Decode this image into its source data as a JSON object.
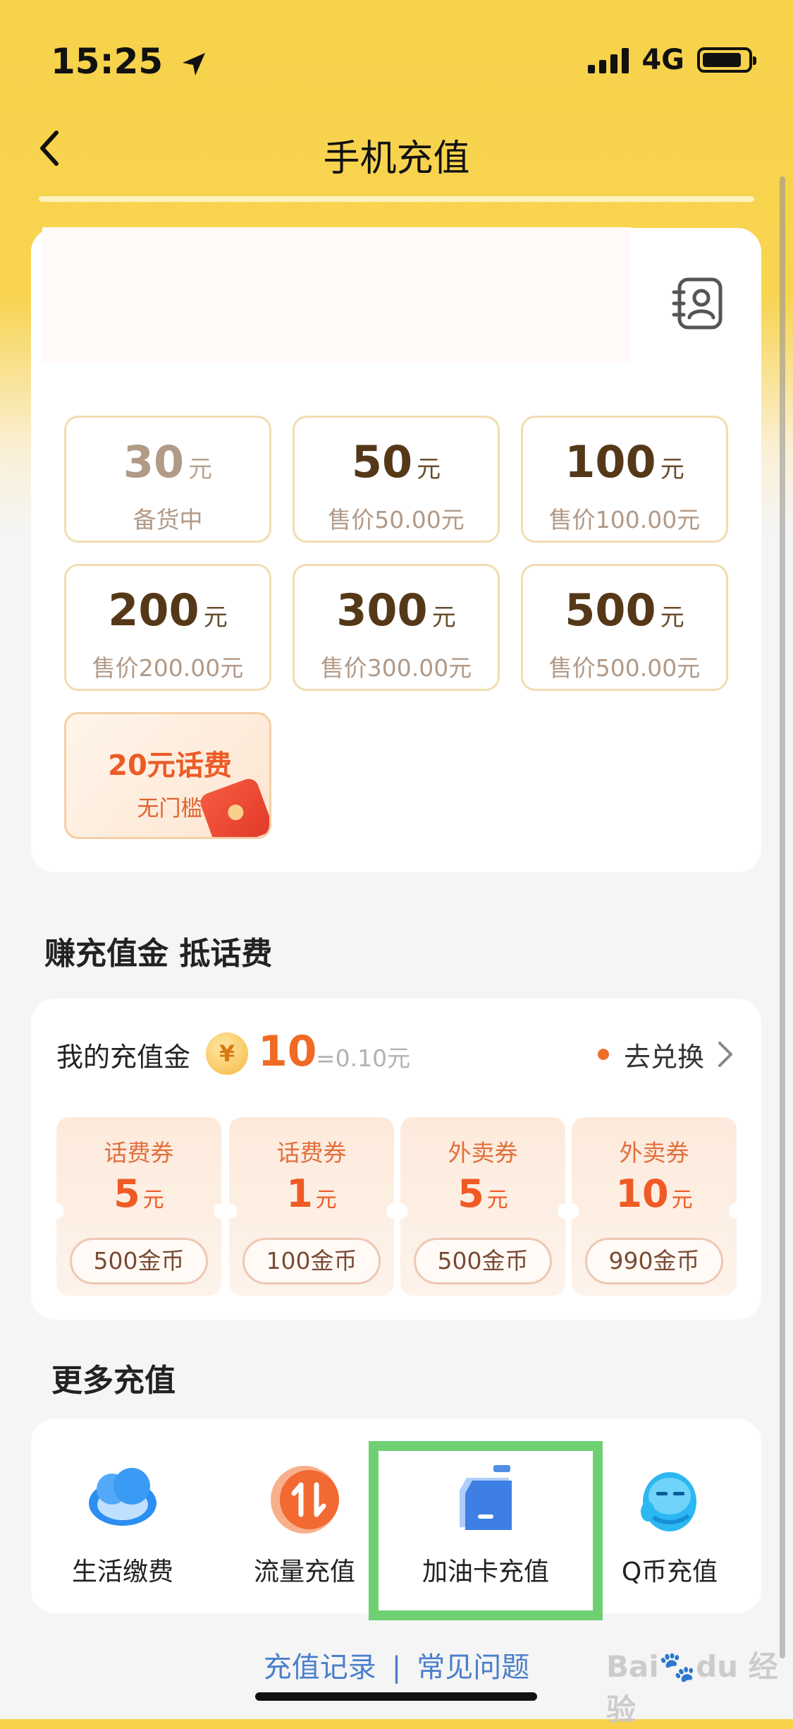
{
  "status_bar": {
    "time": "15:25",
    "network": "4G"
  },
  "nav": {
    "title": "手机充值"
  },
  "topup": {
    "options": [
      {
        "amount": "30",
        "unit": "元",
        "sub": "备货中",
        "disabled": true
      },
      {
        "amount": "50",
        "unit": "元",
        "sub": "售价50.00元"
      },
      {
        "amount": "100",
        "unit": "元",
        "sub": "售价100.00元"
      },
      {
        "amount": "200",
        "unit": "元",
        "sub": "售价200.00元"
      },
      {
        "amount": "300",
        "unit": "元",
        "sub": "售价300.00元"
      },
      {
        "amount": "500",
        "unit": "元",
        "sub": "售价500.00元"
      }
    ],
    "gift": {
      "title": "20元话费",
      "subtitle": "无门槛"
    }
  },
  "earn": {
    "title": "赚充值金 抵话费",
    "my_label": "我的充值金",
    "coin_symbol": "¥",
    "coin_count": "10",
    "coin_equiv": "=0.10元",
    "exchange_label": "去兑换",
    "coupons": [
      {
        "type": "话费券",
        "value": "5",
        "unit": "元",
        "price": "500金币"
      },
      {
        "type": "话费券",
        "value": "1",
        "unit": "元",
        "price": "100金币"
      },
      {
        "type": "外卖券",
        "value": "5",
        "unit": "元",
        "price": "500金币"
      },
      {
        "type": "外卖券",
        "value": "10",
        "unit": "元",
        "price": "990金币"
      }
    ]
  },
  "more": {
    "title": "更多充值",
    "services": [
      {
        "label": "生活缴费",
        "icon": "cloud-icon"
      },
      {
        "label": "流量充值",
        "icon": "data-arrows-icon"
      },
      {
        "label": "加油卡充值",
        "icon": "fuel-card-icon"
      },
      {
        "label": "Q币充值",
        "icon": "qq-penguin-icon"
      }
    ]
  },
  "footer": {
    "records": "充值记录",
    "faq": "常见问题",
    "separator": "|"
  },
  "colors": {
    "header_yellow": "#f7d24a",
    "accent_orange": "#ef6a23",
    "link_blue": "#4b7fcb",
    "highlight_green": "#6fcf73"
  }
}
